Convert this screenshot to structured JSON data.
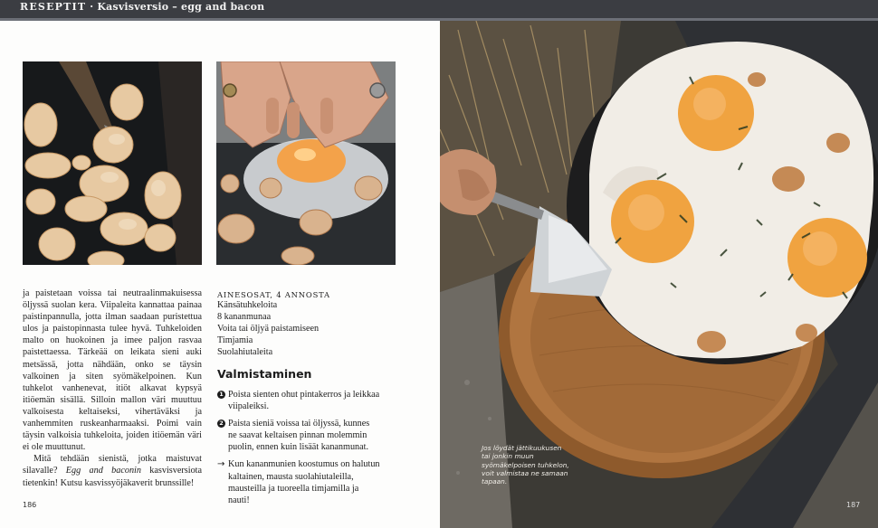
{
  "header": {
    "section": "RESEPTIT",
    "separator": "·",
    "title": "Kasvisversio – egg and bacon"
  },
  "left_page": {
    "photos": [
      "chanterelle-frying-icon",
      "egg-cracking-icon"
    ],
    "body": {
      "para1": "ja paistetaan voissa tai neutraalinmakuisessa öljyssä suolan kera. Viipaleita kannattaa painaa paistinpannulla, jotta ilman saadaan puristettua ulos ja paistopinnasta tulee hyvä. Tuhkeloiden malto on huokoinen ja imee paljon rasvaa paistettaessa. Tärkeää on leikata sieni auki metsässä, jotta nähdään, onko se täysin valkoinen ja siten syömäkelpoinen. Kun tuhkelot vanhenevat, itiöt alkavat kypsyä itiöemän sisällä. Silloin mallon väri muuttuu valkoisesta keltaiseksi, vihertäväksi ja vanhemmiten ruskeanharmaaksi. Poimi vain täysin valkoisia tuhkeloita, joiden itiöemän väri ei ole muuttunut.",
      "para2_a": "Mitä tehdään sienistä, jotka maistuvat silavalle? ",
      "para2_em": "Egg and baconin",
      "para2_b": " kasvisversiota tietenkin! Kutsu kasvissyöjäkaverit brunssille!"
    },
    "ingredients": {
      "heading": "AINESOSAT, 4 ANNOSTA",
      "items": [
        "Känsätuhkeloita",
        "8 kananmunaa",
        "Voita tai öljyä paistamiseen",
        "Timjamia",
        "Suolahiutaleita"
      ]
    },
    "method": {
      "title": "Valmistaminen",
      "step1_num": "1",
      "step1": "Poista sienten ohut pintakerros ja leikkaa viipaleiksi.",
      "step2_num": "2",
      "step2": "Paista sieniä voissa tai öljyssä, kunnes ne saavat keltaisen pinnan molemmin puolin, ennen kuin lisäät kananmunat.",
      "step3_mark": "→",
      "step3": "Kun kananmunien koostumus on halutun kaltainen, mausta suolahiutaleilla, mausteilla ja tuoreella timjamilla ja nauti!"
    },
    "page_number": "186"
  },
  "right_page": {
    "photo": "fried-eggs-skillet-icon",
    "caption": "Jos löydät jättikuukusen tai jonkin muun syömäkelpoisen tuhkelon, voit valmistaa ne samaan tapaan.",
    "page_number": "187"
  },
  "colors": {
    "header_bg": "#3b3d42",
    "yolk": "#f0a340",
    "wood": "#a86a38"
  }
}
